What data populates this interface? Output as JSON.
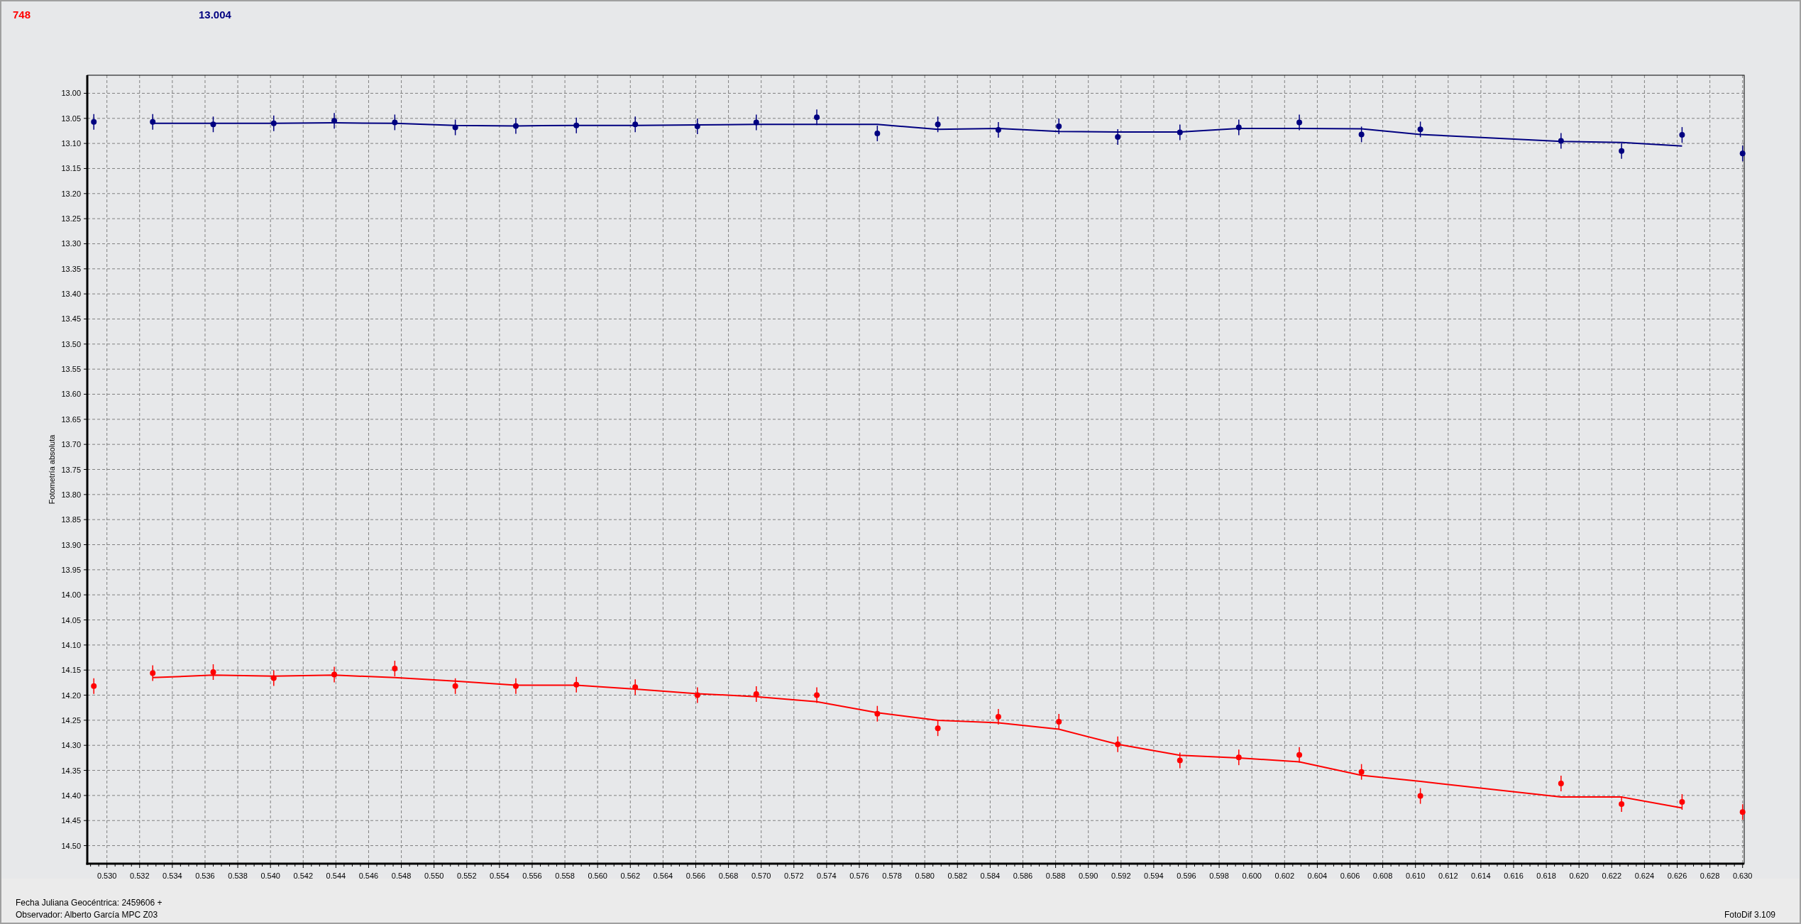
{
  "readouts": [
    {
      "text": "748",
      "color": "#ff0000"
    },
    {
      "text": "13.004",
      "color": "#000080"
    }
  ],
  "chart_data": {
    "type": "scatter",
    "grid": true,
    "ylabel": "Fotometría absoluta",
    "xlim": [
      0.5288,
      0.6301
    ],
    "ylim": [
      14.536,
      12.964
    ],
    "xticks": [
      {
        "value": 0.53,
        "label": "0.530"
      },
      {
        "value": 0.532,
        "label": "0.532"
      },
      {
        "value": 0.534,
        "label": "0.534"
      },
      {
        "value": 0.536,
        "label": "0.536"
      },
      {
        "value": 0.538,
        "label": "0.538"
      },
      {
        "value": 0.54,
        "label": "0.540"
      },
      {
        "value": 0.542,
        "label": "0.542"
      },
      {
        "value": 0.544,
        "label": "0.544"
      },
      {
        "value": 0.546,
        "label": "0.546"
      },
      {
        "value": 0.548,
        "label": "0.548"
      },
      {
        "value": 0.55,
        "label": "0.550"
      },
      {
        "value": 0.552,
        "label": "0.552"
      },
      {
        "value": 0.554,
        "label": "0.554"
      },
      {
        "value": 0.556,
        "label": "0.556"
      },
      {
        "value": 0.558,
        "label": "0.558"
      },
      {
        "value": 0.56,
        "label": "0.560"
      },
      {
        "value": 0.562,
        "label": "0.562"
      },
      {
        "value": 0.564,
        "label": "0.564"
      },
      {
        "value": 0.566,
        "label": "0.566"
      },
      {
        "value": 0.568,
        "label": "0.568"
      },
      {
        "value": 0.57,
        "label": "0.570"
      },
      {
        "value": 0.572,
        "label": "0.572"
      },
      {
        "value": 0.574,
        "label": "0.574"
      },
      {
        "value": 0.576,
        "label": "0.576"
      },
      {
        "value": 0.578,
        "label": "0.578"
      },
      {
        "value": 0.58,
        "label": "0.580"
      },
      {
        "value": 0.582,
        "label": "0.582"
      },
      {
        "value": 0.584,
        "label": "0.584"
      },
      {
        "value": 0.586,
        "label": "0.586"
      },
      {
        "value": 0.588,
        "label": "0.588"
      },
      {
        "value": 0.59,
        "label": "0.590"
      },
      {
        "value": 0.592,
        "label": "0.592"
      },
      {
        "value": 0.594,
        "label": "0.594"
      },
      {
        "value": 0.596,
        "label": "0.596"
      },
      {
        "value": 0.598,
        "label": "0.598"
      },
      {
        "value": 0.6,
        "label": "0.600"
      },
      {
        "value": 0.602,
        "label": "0.602"
      },
      {
        "value": 0.604,
        "label": "0.604"
      },
      {
        "value": 0.606,
        "label": "0.606"
      },
      {
        "value": 0.608,
        "label": "0.608"
      },
      {
        "value": 0.61,
        "label": "0.610"
      },
      {
        "value": 0.612,
        "label": "0.612"
      },
      {
        "value": 0.614,
        "label": "0.614"
      },
      {
        "value": 0.616,
        "label": "0.616"
      },
      {
        "value": 0.618,
        "label": "0.618"
      },
      {
        "value": 0.62,
        "label": "0.620"
      },
      {
        "value": 0.622,
        "label": "0.622"
      },
      {
        "value": 0.624,
        "label": "0.624"
      },
      {
        "value": 0.626,
        "label": "0.626"
      },
      {
        "value": 0.628,
        "label": "0.628"
      },
      {
        "value": 0.63,
        "label": "0.630"
      }
    ],
    "yticks": [
      {
        "value": 13.0,
        "label": "13.00"
      },
      {
        "value": 13.05,
        "label": "13.05"
      },
      {
        "value": 13.1,
        "label": "13.10"
      },
      {
        "value": 13.15,
        "label": "13.15"
      },
      {
        "value": 13.2,
        "label": "13.20"
      },
      {
        "value": 13.25,
        "label": "13.25"
      },
      {
        "value": 13.3,
        "label": "13.30"
      },
      {
        "value": 13.35,
        "label": "13.35"
      },
      {
        "value": 13.4,
        "label": "13.40"
      },
      {
        "value": 13.45,
        "label": "13.45"
      },
      {
        "value": 13.5,
        "label": "13.50"
      },
      {
        "value": 13.55,
        "label": "13.55"
      },
      {
        "value": 13.6,
        "label": "13.60"
      },
      {
        "value": 13.65,
        "label": "13.65"
      },
      {
        "value": 13.7,
        "label": "13.70"
      },
      {
        "value": 13.75,
        "label": "13.75"
      },
      {
        "value": 13.8,
        "label": "13.80"
      },
      {
        "value": 13.85,
        "label": "13.85"
      },
      {
        "value": 13.9,
        "label": "13.90"
      },
      {
        "value": 13.95,
        "label": "13.95"
      },
      {
        "value": 14.0,
        "label": "14.00"
      },
      {
        "value": 14.05,
        "label": "14.05"
      },
      {
        "value": 14.1,
        "label": "14.10"
      },
      {
        "value": 14.15,
        "label": "14.15"
      },
      {
        "value": 14.2,
        "label": "14.20"
      },
      {
        "value": 14.25,
        "label": "14.25"
      },
      {
        "value": 14.3,
        "label": "14.30"
      },
      {
        "value": 14.35,
        "label": "14.35"
      },
      {
        "value": 14.4,
        "label": "14.40"
      },
      {
        "value": 14.45,
        "label": "14.45"
      },
      {
        "value": 14.5,
        "label": "14.50"
      }
    ],
    "x": [
      0.5292,
      0.5328,
      0.5365,
      0.5402,
      0.5439,
      0.5476,
      0.5513,
      0.555,
      0.5587,
      0.5623,
      0.5661,
      0.5697,
      0.5734,
      0.5771,
      0.5808,
      0.5845,
      0.5882,
      0.5918,
      0.5956,
      0.5992,
      0.6029,
      0.6067,
      0.6103,
      0.6189,
      0.6226,
      0.6263,
      0.63
    ],
    "series": [
      {
        "type": "scatter",
        "marker": "circle",
        "color": "#000080",
        "values": [
          13.057,
          13.057,
          13.062,
          13.06,
          13.055,
          13.058,
          13.068,
          13.065,
          13.064,
          13.062,
          13.066,
          13.058,
          13.048,
          13.08,
          13.062,
          13.073,
          13.066,
          13.087,
          13.078,
          13.068,
          13.058,
          13.082,
          13.072,
          13.095,
          13.115,
          13.083,
          13.12
        ]
      },
      {
        "type": "line",
        "color": "#000080",
        "values": [
          null,
          13.06,
          13.06,
          13.06,
          13.059,
          13.06,
          13.064,
          13.065,
          13.064,
          13.064,
          13.063,
          13.062,
          13.062,
          13.062,
          13.072,
          13.07,
          13.076,
          13.077,
          13.077,
          13.07,
          13.07,
          13.071,
          13.082,
          13.096,
          13.098,
          13.105,
          null
        ]
      },
      {
        "type": "scatter",
        "marker": "circle",
        "color": "#ff0000",
        "values": [
          14.182,
          14.156,
          14.154,
          14.166,
          14.159,
          14.147,
          14.182,
          14.182,
          14.179,
          14.184,
          14.2,
          14.198,
          14.2,
          14.237,
          14.266,
          14.243,
          14.253,
          14.298,
          14.33,
          14.324,
          14.319,
          14.353,
          14.401,
          14.376,
          14.417,
          14.413,
          14.433
        ]
      },
      {
        "type": "line",
        "color": "#ff0000",
        "values": [
          null,
          14.165,
          14.16,
          14.162,
          14.16,
          14.165,
          14.172,
          14.18,
          14.18,
          14.188,
          14.197,
          14.203,
          14.213,
          14.235,
          14.25,
          14.255,
          14.268,
          14.298,
          14.32,
          14.325,
          14.333,
          14.36,
          14.372,
          14.403,
          14.403,
          14.425,
          null
        ]
      }
    ]
  },
  "footer": {
    "lines": [
      "Fecha Juliana Geocéntrica: 2459606 +",
      "Observador: Alberto García MPC Z03"
    ],
    "version": "FotoDif 3.109"
  }
}
